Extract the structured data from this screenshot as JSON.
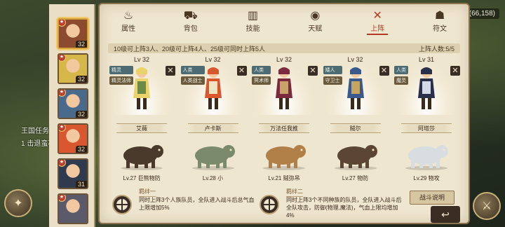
{
  "world": {
    "coord_readout": "(66,158)",
    "line1": "王国任务",
    "line2": "1 击退蛮石"
  },
  "tabs": [
    {
      "label": "属性",
      "icon": "flame-icon"
    },
    {
      "label": "背包",
      "icon": "backpack-icon"
    },
    {
      "label": "技能",
      "icon": "book-icon"
    },
    {
      "label": "天赋",
      "icon": "eye-icon"
    },
    {
      "label": "上阵",
      "icon": "crossed-swords-icon"
    },
    {
      "label": "符文",
      "icon": "rune-icon"
    }
  ],
  "active_tab": "上阵",
  "deploy": {
    "rule": "10级可上阵3人、20级可上阵4人、25级可同时上阵5人",
    "count": "上阵人数:5/5"
  },
  "heroes": [
    {
      "level": "Lv 32",
      "name": "艾薇",
      "tags": [
        "精灵",
        "精灵法师"
      ],
      "colors": [
        "#e9d36a",
        "#6b8a4a"
      ]
    },
    {
      "level": "Lv 32",
      "name": "卢卡斯",
      "tags": [
        "人类",
        "人类战士"
      ],
      "colors": [
        "#d8572e",
        "#f1e4c3"
      ]
    },
    {
      "level": "Lv 32",
      "name": "万法任我推",
      "tags": [
        "人类",
        "冥术师"
      ],
      "colors": [
        "#7c2a3e",
        "#c9a26a"
      ]
    },
    {
      "level": "Lv 32",
      "name": "贼尔",
      "tags": [
        "矮人",
        "守卫士"
      ],
      "colors": [
        "#3b5a8c",
        "#c5a560"
      ]
    },
    {
      "level": "Lv 31",
      "name": "阿塔莎",
      "tags": [
        "人类",
        "魔灵"
      ],
      "colors": [
        "#2a2f4a",
        "#d4dbe6"
      ]
    }
  ],
  "pets": [
    {
      "label": "Lv.27 巨熊物防"
    },
    {
      "label": "Lv.28 小"
    },
    {
      "label": "Lv.21 贼弥吊"
    },
    {
      "label": "Lv.27 物防"
    },
    {
      "label": "Lv.29 物攻"
    }
  ],
  "bonds": [
    {
      "title": "羁绊一",
      "desc": "同时上阵3个人族队员，全队进入战斗后总气血上限增加5%"
    },
    {
      "title": "羁绊二",
      "desc": "同时上阵3个不同种族的队员，全队进入战斗后全队攻击，防御(物理,魔法)，气血上限均增加4%"
    }
  ],
  "battle_help": "战斗说明",
  "roster": [
    {
      "level": "32",
      "color": "#8c4a2e"
    },
    {
      "level": "32",
      "color": "#d6b84a"
    },
    {
      "level": "32",
      "color": "#4a6a8c"
    },
    {
      "level": "32",
      "color": "#d8572e"
    },
    {
      "level": "31",
      "color": "#2f3a4e"
    },
    {
      "level": "",
      "color": "#5a5a6a"
    }
  ]
}
